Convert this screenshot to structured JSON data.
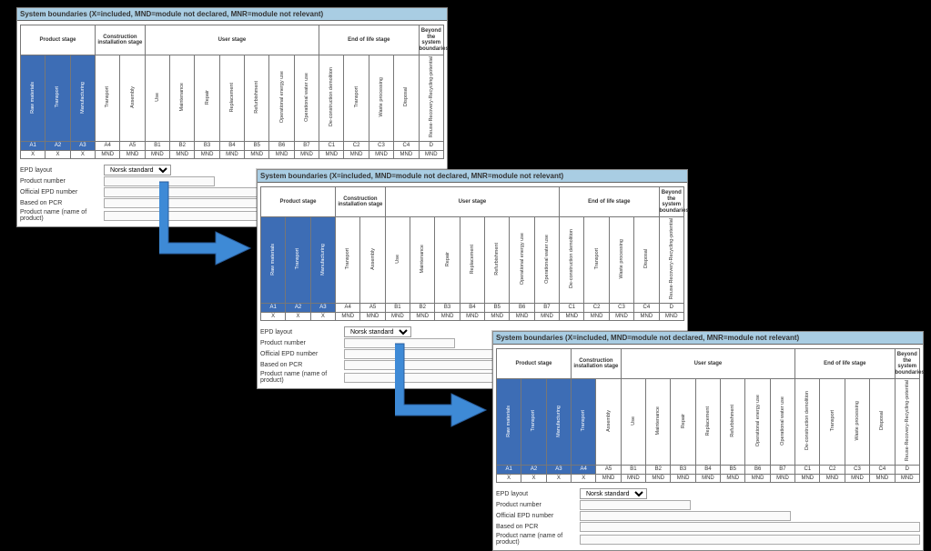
{
  "title": "System boundaries (X=included, MND=module not declared, MNR=module not relevant)",
  "groups": [
    {
      "label": "Product stage",
      "span": 3
    },
    {
      "label": "Construction installation stage",
      "span": 2
    },
    {
      "label": "User stage",
      "span": 7
    },
    {
      "label": "End of life stage",
      "span": 4
    },
    {
      "label": "Beyond the system boundaries",
      "span": 1
    }
  ],
  "modules": [
    {
      "code": "A1",
      "name": "Raw materials"
    },
    {
      "code": "A2",
      "name": "Transport"
    },
    {
      "code": "A3",
      "name": "Manufacturing"
    },
    {
      "code": "A4",
      "name": "Transport"
    },
    {
      "code": "A5",
      "name": "Assembly"
    },
    {
      "code": "B1",
      "name": "Use"
    },
    {
      "code": "B2",
      "name": "Maintenance"
    },
    {
      "code": "B3",
      "name": "Repair"
    },
    {
      "code": "B4",
      "name": "Replacement"
    },
    {
      "code": "B5",
      "name": "Refurbishment"
    },
    {
      "code": "B6",
      "name": "Operational energy use"
    },
    {
      "code": "B7",
      "name": "Operational water use"
    },
    {
      "code": "C1",
      "name": "De-construction demolition"
    },
    {
      "code": "C2",
      "name": "Transport"
    },
    {
      "code": "C3",
      "name": "Waste processing"
    },
    {
      "code": "C4",
      "name": "Disposal"
    },
    {
      "code": "D",
      "name": "Reuse-Recovery-Recycling-potential"
    }
  ],
  "panels": [
    {
      "included": [
        "A1",
        "A2",
        "A3"
      ]
    },
    {
      "included": [
        "A1",
        "A2",
        "A3"
      ]
    },
    {
      "included": [
        "A1",
        "A2",
        "A3",
        "A4"
      ]
    }
  ],
  "mnd": "MND",
  "x": "X",
  "formLabels": {
    "epdLayout": "EPD layout",
    "productNumber": "Product number",
    "officialEpd": "Official EPD number",
    "basedOnPcr": "Based on PCR",
    "productName": "Product name (name of product)"
  },
  "selectValue": "Norsk standard"
}
